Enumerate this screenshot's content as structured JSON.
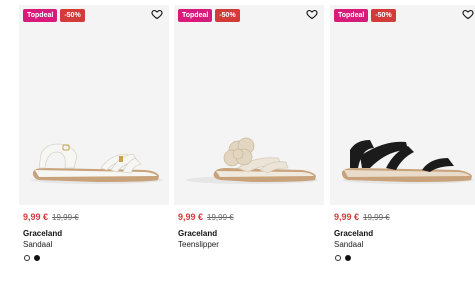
{
  "products": [
    {
      "badges": {
        "top": "Topdeal",
        "sale": "-50%"
      },
      "price": "9,99 €",
      "old_price": "19,99 €",
      "brand": "Graceland",
      "name": "Sandaal",
      "colors": [
        "white",
        "black"
      ],
      "shoe_color": "#f6f6f3",
      "sole_color": "#c8a27a"
    },
    {
      "badges": {
        "top": "Topdeal",
        "sale": "-50%"
      },
      "price": "9,99 €",
      "old_price": "19,99 €",
      "brand": "Graceland",
      "name": "Teenslipper",
      "colors": [],
      "shoe_color": "#ece4d6",
      "sole_color": "#c8a27a"
    },
    {
      "badges": {
        "top": "Topdeal",
        "sale": "-50%"
      },
      "price": "9,99 €",
      "old_price": "19,99 €",
      "brand": "Graceland",
      "name": "Sandaal",
      "colors": [
        "white",
        "black"
      ],
      "shoe_color": "#1b1b1b",
      "sole_color": "#c8a27a"
    }
  ],
  "icons": {
    "wishlist": "heart-outline-icon"
  }
}
